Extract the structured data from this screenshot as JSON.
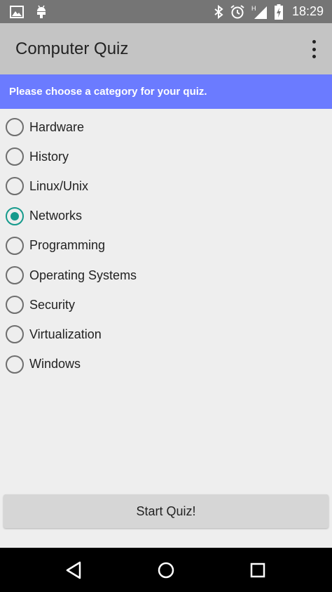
{
  "status_bar": {
    "time": "18:29",
    "network_type": "H",
    "icons": [
      "image-icon",
      "android-debug-icon",
      "bluetooth-icon",
      "alarm-icon",
      "signal-icon",
      "battery-charging-icon"
    ]
  },
  "app_bar": {
    "title": "Computer Quiz",
    "menu_icon": "overflow-menu-icon"
  },
  "banner": {
    "text": "Please choose a category for your quiz."
  },
  "categories": {
    "items": [
      {
        "label": "Hardware",
        "selected": false
      },
      {
        "label": "History",
        "selected": false
      },
      {
        "label": "Linux/Unix",
        "selected": false
      },
      {
        "label": "Networks",
        "selected": true
      },
      {
        "label": "Programming",
        "selected": false
      },
      {
        "label": "Operating Systems",
        "selected": false
      },
      {
        "label": "Security",
        "selected": false
      },
      {
        "label": "Virtualization",
        "selected": false
      },
      {
        "label": "Windows",
        "selected": false
      }
    ]
  },
  "start_button": {
    "label": "Start Quiz!"
  },
  "nav_bar": {
    "icons": [
      "back-icon",
      "home-icon",
      "recents-icon"
    ]
  },
  "colors": {
    "status_bar": "#757575",
    "app_bar": "#c4c4c4",
    "banner": "#6b7bff",
    "accent": "#159a8c",
    "background": "#eeeeee"
  }
}
